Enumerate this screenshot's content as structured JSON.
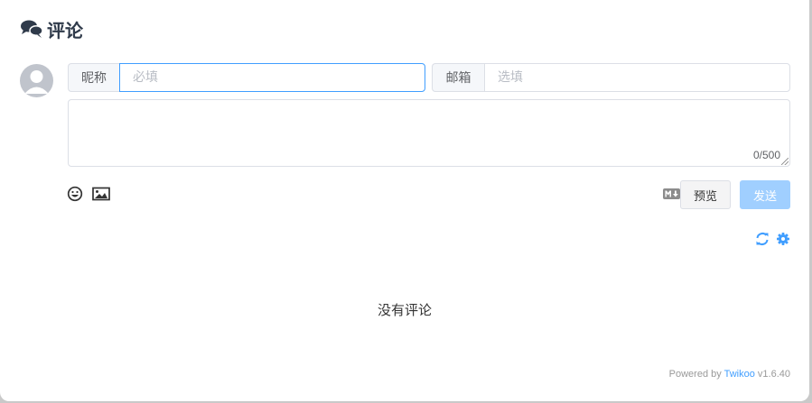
{
  "header": {
    "title": "评论",
    "icon": "comments-icon"
  },
  "form": {
    "nick_label": "昵称",
    "nick_placeholder": "必填",
    "mail_label": "邮箱",
    "mail_placeholder": "选填",
    "counter": "0/500"
  },
  "toolbar": {
    "emoji_icon": "smile-icon",
    "image_icon": "image-icon",
    "markdown_icon": "markdown-icon",
    "preview_label": "预览",
    "send_label": "发送"
  },
  "actions": {
    "refresh_icon": "refresh-icon",
    "settings_icon": "gear-icon"
  },
  "comments": {
    "empty_text": "没有评论"
  },
  "footer": {
    "powered_by": "Powered by",
    "brand": "Twikoo",
    "version": "v1.6.40"
  },
  "colors": {
    "accent": "#409eff",
    "send_disabled": "#a0cfff",
    "heading": "#2f3a4a"
  }
}
